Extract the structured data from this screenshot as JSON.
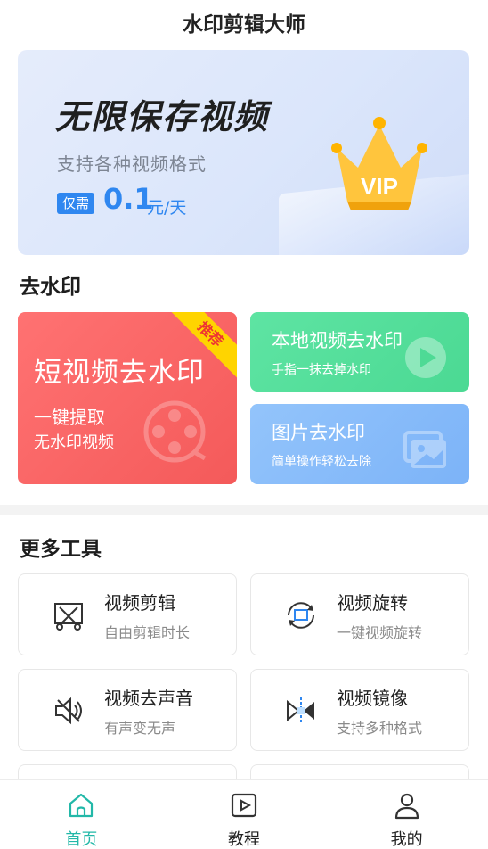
{
  "header": {
    "title": "水印剪辑大师"
  },
  "banner": {
    "headline": "无限保存视频",
    "subtitle": "支持各种视频格式",
    "price_tag": "仅需",
    "price": "0.1",
    "price_unit": "元/天",
    "badge": "VIP"
  },
  "remove_section": {
    "title": "去水印",
    "main_card": {
      "title": "短视频去水印",
      "line1": "一键提取",
      "line2": "无水印视频",
      "ribbon": "推荐"
    },
    "cards": [
      {
        "title": "本地视频去水印",
        "desc": "手指一抹去掉水印",
        "icon": "play-icon"
      },
      {
        "title": "图片去水印",
        "desc": "简单操作轻松去除",
        "icon": "image-icon"
      }
    ]
  },
  "tools_section": {
    "title": "更多工具",
    "tools": [
      {
        "name": "视频剪辑",
        "desc": "自由剪辑时长",
        "icon": "scissors-icon"
      },
      {
        "name": "视频旋转",
        "desc": "一键视频旋转",
        "icon": "rotate-icon"
      },
      {
        "name": "视频去声音",
        "desc": "有声变无声",
        "icon": "mute-icon"
      },
      {
        "name": "视频镜像",
        "desc": "支持多种格式",
        "icon": "mirror-icon"
      }
    ]
  },
  "tabbar": {
    "tabs": [
      {
        "label": "首页",
        "icon": "home-icon",
        "active": true
      },
      {
        "label": "教程",
        "icon": "video-icon",
        "active": false
      },
      {
        "label": "我的",
        "icon": "user-icon",
        "active": false
      }
    ]
  },
  "colors": {
    "accent": "#22b8a8",
    "price": "#2f87f0",
    "red_card": "#f45a5a",
    "green_card": "#4bd993",
    "blue_card": "#7cb3f8"
  }
}
